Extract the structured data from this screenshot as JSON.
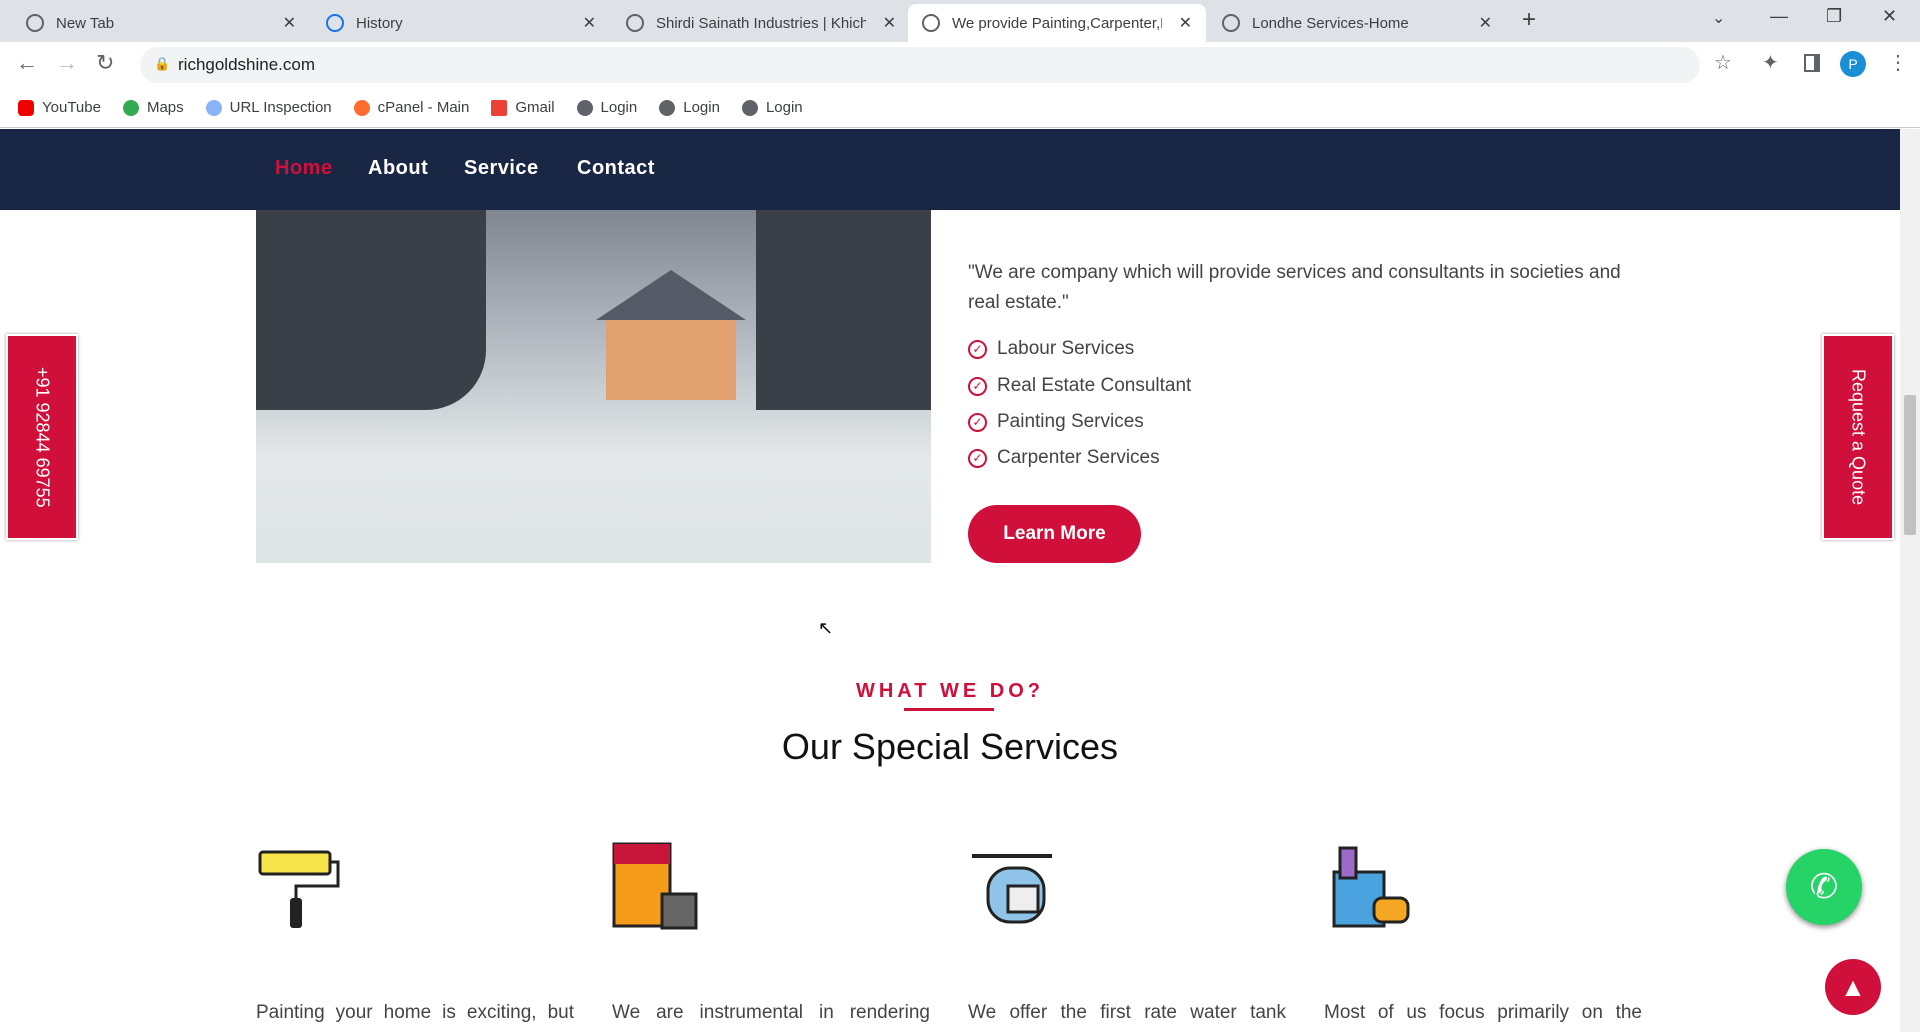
{
  "browser": {
    "tabs": [
      {
        "label": "New Tab"
      },
      {
        "label": "History"
      },
      {
        "label": "Shirdi Sainath Industries | Khichdi"
      },
      {
        "label": "We provide Painting,Carpenter,D"
      },
      {
        "label": "Londhe Services-Home"
      }
    ],
    "url": "richgoldshine.com",
    "profile": "P",
    "bookmarks": [
      "YouTube",
      "Maps",
      "URL Inspection",
      "cPanel - Main",
      "Gmail",
      "Login",
      "Login",
      "Login"
    ]
  },
  "nav": {
    "items": [
      "Home",
      "About",
      "Service",
      "Contact"
    ],
    "active": "Home"
  },
  "about": {
    "quote": "\"We are company which will provide services and consultants in societies and real estate.\"",
    "list": [
      "Labour Services",
      "Real Estate Consultant",
      "Painting Services",
      "Carpenter Services"
    ],
    "button": "Learn More"
  },
  "side": {
    "phone": "+91 92844 69755",
    "quote": "Request a Quote"
  },
  "services": {
    "eyebrow": "WHAT WE DO?",
    "title": "Our Special Services",
    "items": [
      {
        "icon": "paint-roller-icon",
        "text": "Painting your home is exciting, but"
      },
      {
        "icon": "paint-bucket-icon",
        "text": "We are instrumental in rendering"
      },
      {
        "icon": "water-tank-cleaning-icon",
        "text": "We offer the first rate water tank"
      },
      {
        "icon": "cleaning-supplies-icon",
        "text": "Most of us focus primarily on the"
      }
    ]
  },
  "colors": {
    "accent": "#d0103a",
    "nav": "#1a2744",
    "whatsapp": "#25d366"
  }
}
